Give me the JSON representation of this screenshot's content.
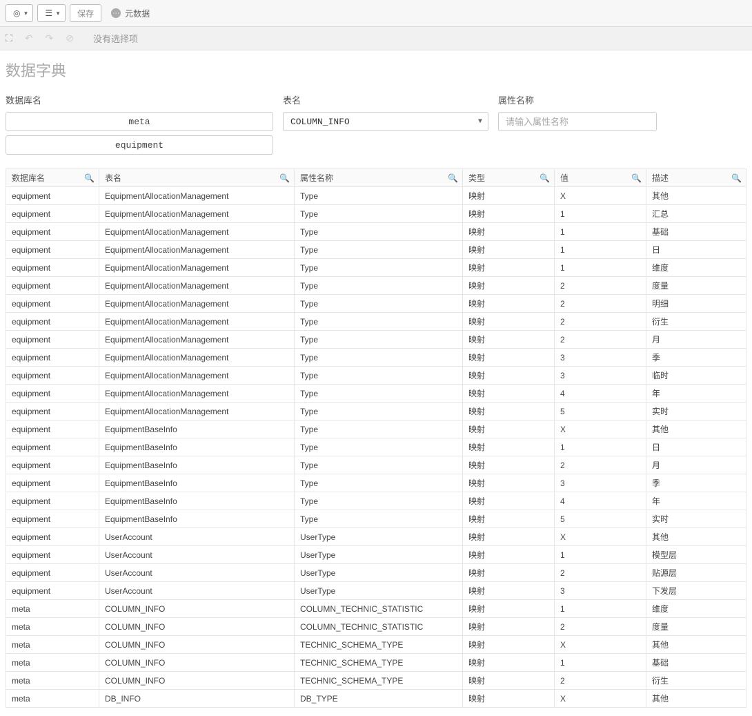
{
  "toolbar": {
    "save_label": "保存",
    "meta_label": "元数据"
  },
  "subbar": {
    "message": "没有选择项"
  },
  "page": {
    "title": "数据字典"
  },
  "filters": {
    "db_label": "数据库名",
    "db_values": [
      "meta",
      "equipment"
    ],
    "table_label": "表名",
    "table_value": "COLUMN_INFO",
    "prop_label": "属性名称",
    "prop_placeholder": "请输入属性名称"
  },
  "columns": {
    "db": "数据库名",
    "tbl": "表名",
    "prop": "属性名称",
    "type": "类型",
    "val": "值",
    "desc": "描述"
  },
  "rows": [
    {
      "db": "equipment",
      "tbl": "EquipmentAllocationManagement",
      "prop": "Type",
      "type": "映射",
      "val": "X",
      "desc": "其他"
    },
    {
      "db": "equipment",
      "tbl": "EquipmentAllocationManagement",
      "prop": "Type",
      "type": "映射",
      "val": "1",
      "desc": "汇总"
    },
    {
      "db": "equipment",
      "tbl": "EquipmentAllocationManagement",
      "prop": "Type",
      "type": "映射",
      "val": "1",
      "desc": "基础"
    },
    {
      "db": "equipment",
      "tbl": "EquipmentAllocationManagement",
      "prop": "Type",
      "type": "映射",
      "val": "1",
      "desc": "日"
    },
    {
      "db": "equipment",
      "tbl": "EquipmentAllocationManagement",
      "prop": "Type",
      "type": "映射",
      "val": "1",
      "desc": "维度"
    },
    {
      "db": "equipment",
      "tbl": "EquipmentAllocationManagement",
      "prop": "Type",
      "type": "映射",
      "val": "2",
      "desc": "度量"
    },
    {
      "db": "equipment",
      "tbl": "EquipmentAllocationManagement",
      "prop": "Type",
      "type": "映射",
      "val": "2",
      "desc": "明细"
    },
    {
      "db": "equipment",
      "tbl": "EquipmentAllocationManagement",
      "prop": "Type",
      "type": "映射",
      "val": "2",
      "desc": "衍生"
    },
    {
      "db": "equipment",
      "tbl": "EquipmentAllocationManagement",
      "prop": "Type",
      "type": "映射",
      "val": "2",
      "desc": "月"
    },
    {
      "db": "equipment",
      "tbl": "EquipmentAllocationManagement",
      "prop": "Type",
      "type": "映射",
      "val": "3",
      "desc": "季"
    },
    {
      "db": "equipment",
      "tbl": "EquipmentAllocationManagement",
      "prop": "Type",
      "type": "映射",
      "val": "3",
      "desc": "临时"
    },
    {
      "db": "equipment",
      "tbl": "EquipmentAllocationManagement",
      "prop": "Type",
      "type": "映射",
      "val": "4",
      "desc": "年"
    },
    {
      "db": "equipment",
      "tbl": "EquipmentAllocationManagement",
      "prop": "Type",
      "type": "映射",
      "val": "5",
      "desc": "实时"
    },
    {
      "db": "equipment",
      "tbl": "EquipmentBaseInfo",
      "prop": "Type",
      "type": "映射",
      "val": "X",
      "desc": "其他"
    },
    {
      "db": "equipment",
      "tbl": "EquipmentBaseInfo",
      "prop": "Type",
      "type": "映射",
      "val": "1",
      "desc": "日"
    },
    {
      "db": "equipment",
      "tbl": "EquipmentBaseInfo",
      "prop": "Type",
      "type": "映射",
      "val": "2",
      "desc": "月"
    },
    {
      "db": "equipment",
      "tbl": "EquipmentBaseInfo",
      "prop": "Type",
      "type": "映射",
      "val": "3",
      "desc": "季"
    },
    {
      "db": "equipment",
      "tbl": "EquipmentBaseInfo",
      "prop": "Type",
      "type": "映射",
      "val": "4",
      "desc": "年"
    },
    {
      "db": "equipment",
      "tbl": "EquipmentBaseInfo",
      "prop": "Type",
      "type": "映射",
      "val": "5",
      "desc": "实时"
    },
    {
      "db": "equipment",
      "tbl": "UserAccount",
      "prop": "UserType",
      "type": "映射",
      "val": "X",
      "desc": "其他"
    },
    {
      "db": "equipment",
      "tbl": "UserAccount",
      "prop": "UserType",
      "type": "映射",
      "val": "1",
      "desc": "模型层"
    },
    {
      "db": "equipment",
      "tbl": "UserAccount",
      "prop": "UserType",
      "type": "映射",
      "val": "2",
      "desc": "贴源层"
    },
    {
      "db": "equipment",
      "tbl": "UserAccount",
      "prop": "UserType",
      "type": "映射",
      "val": "3",
      "desc": "下发层"
    },
    {
      "db": "meta",
      "tbl": "COLUMN_INFO",
      "prop": "COLUMN_TECHNIC_STATISTIC",
      "type": "映射",
      "val": "1",
      "desc": "维度"
    },
    {
      "db": "meta",
      "tbl": "COLUMN_INFO",
      "prop": "COLUMN_TECHNIC_STATISTIC",
      "type": "映射",
      "val": "2",
      "desc": "度量"
    },
    {
      "db": "meta",
      "tbl": "COLUMN_INFO",
      "prop": "TECHNIC_SCHEMA_TYPE",
      "type": "映射",
      "val": "X",
      "desc": "其他"
    },
    {
      "db": "meta",
      "tbl": "COLUMN_INFO",
      "prop": "TECHNIC_SCHEMA_TYPE",
      "type": "映射",
      "val": "1",
      "desc": "基础"
    },
    {
      "db": "meta",
      "tbl": "COLUMN_INFO",
      "prop": "TECHNIC_SCHEMA_TYPE",
      "type": "映射",
      "val": "2",
      "desc": "衍生"
    },
    {
      "db": "meta",
      "tbl": "DB_INFO",
      "prop": "DB_TYPE",
      "type": "映射",
      "val": "X",
      "desc": "其他"
    }
  ]
}
